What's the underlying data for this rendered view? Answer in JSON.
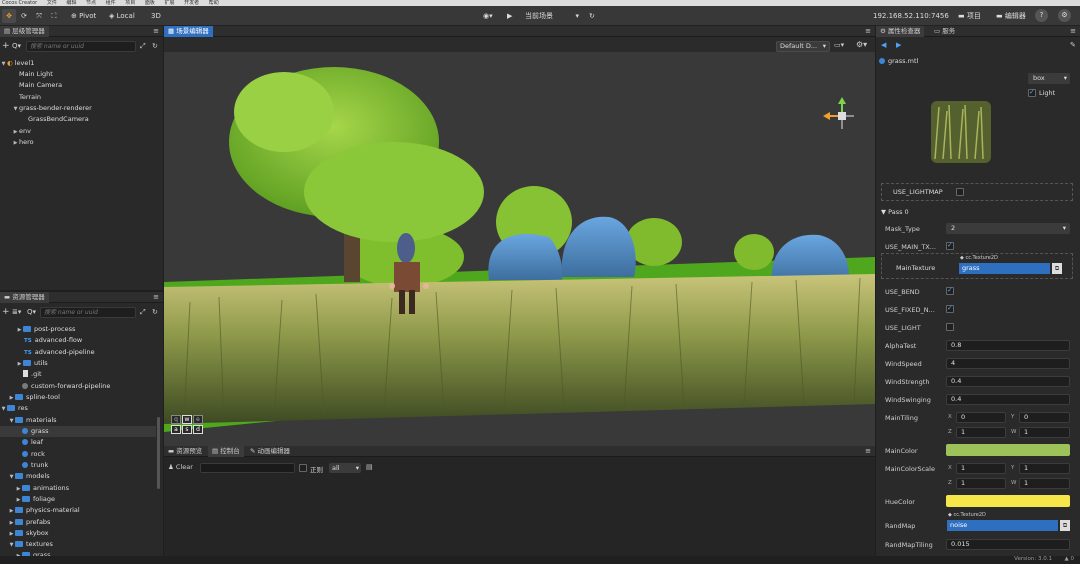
{
  "menubar": {
    "items": [
      "Cocos Creator",
      "文件",
      "编辑",
      "节点",
      "组件",
      "项目",
      "面板",
      "扩展",
      "开发者",
      "帮助"
    ]
  },
  "toolbar": {
    "pivot": "Pivot",
    "local": "Local",
    "mode_3d": "3D",
    "scene_select": "当前场景",
    "ip": "192.168.52.110:7456",
    "project_btn": "项目",
    "editor_btn": "编辑器"
  },
  "hierarchy": {
    "tab": "层级管理器",
    "search_placeholder": "搜索 name or uuid",
    "items": [
      "level1",
      "Main Light",
      "Main Camera",
      "Terrain",
      "grass-bender-renderer",
      "GrassBendCamera",
      "env",
      "hero"
    ]
  },
  "assets": {
    "tab": "资源管理器",
    "search_placeholder": "搜索 name or uuid",
    "items": [
      "post-process",
      "advanced-flow",
      "advanced-pipeline",
      "utils",
      ".git",
      "custom-forward-pipeline",
      "spline-tool",
      "res",
      "materials",
      "grass",
      "leaf",
      "rock",
      "trunk",
      "models",
      "animations",
      "foliage",
      "physics-material",
      "prefabs",
      "skybox",
      "textures",
      "grass"
    ],
    "ts_label": "TS"
  },
  "scene": {
    "tab": "场景编辑器",
    "camera_select": "Default D...",
    "keys_top": [
      "q",
      "w",
      "e"
    ],
    "keys_bottom": [
      "a",
      "s",
      "d"
    ]
  },
  "console": {
    "tabs": [
      "资源预览",
      "控制台",
      "动画编辑器"
    ],
    "clear": "Clear",
    "regex": "正则",
    "level": "all"
  },
  "inspector": {
    "tabs": [
      "属性检查器",
      "服务"
    ],
    "file": "grass.mtl",
    "preview_shape": "box",
    "light_label": "Light",
    "use_lightmap": "USE_LIGHTMAP",
    "pass": "Pass 0",
    "mask_type_label": "Mask_Type",
    "mask_type_value": "2",
    "use_main_tex": "USE_MAIN_TX...",
    "texture_type": "cc.Texture2D",
    "main_texture_label": "MainTexture",
    "main_texture_value": "grass",
    "use_bend": "USE_BEND",
    "use_fixed": "USE_FIXED_N...",
    "use_light": "USE_LIGHT",
    "alpha_test_label": "AlphaTest",
    "alpha_test": "0.8",
    "wind_speed_label": "WindSpeed",
    "wind_speed": "4",
    "wind_strength_label": "WindStrength",
    "wind_strength": "0.4",
    "wind_swinging_label": "WindSwinging",
    "wind_swinging": "0.4",
    "main_tiling_label": "MainTiling",
    "main_tiling": {
      "x": "0",
      "y": "0",
      "z": "1",
      "w": "1"
    },
    "main_color_label": "MainColor",
    "main_color": "#9dc25a",
    "main_color_scale_label": "MainColorScale",
    "main_color_scale": {
      "x": "1",
      "y": "1",
      "z": "1",
      "w": "1"
    },
    "hue_color_label": "HueColor",
    "hue_color": "#f5e64a",
    "rand_map_label": "RandMap",
    "rand_map_value": "noise",
    "rand_map_tiling_label": "RandMapTiling",
    "rand_map_tiling": "0.015"
  },
  "status": {
    "version": "Version: 3.0.1"
  }
}
